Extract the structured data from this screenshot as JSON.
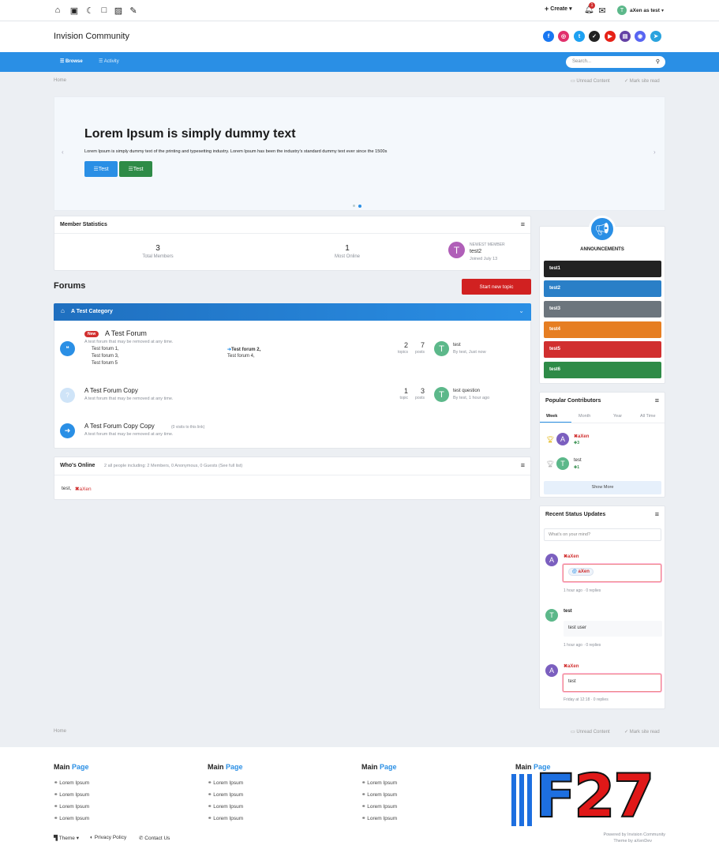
{
  "topbar": {
    "create_label": "Create",
    "notif_count": "1",
    "user_label": "aXen as test",
    "user_initial": "T"
  },
  "header": {
    "brand": "Invision Community"
  },
  "nav": {
    "browse": "Browse",
    "activity": "Activity",
    "search_placeholder": "Search..."
  },
  "breadcrumb": {
    "home": "Home",
    "unread": "Unread Content",
    "mark_read": "Mark site read"
  },
  "hero": {
    "title": "Lorem Ipsum is simply dummy text",
    "text": "Lorem Ipsum is simply dummy text of the printing and typesetting industry. Lorem Ipsum has been the industry's standard dummy text ever since the 1500s",
    "btn1": "Test",
    "btn2": "Test"
  },
  "stats": {
    "title": "Member Statistics",
    "total_members_value": "3",
    "total_members_label": "Total Members",
    "most_online_value": "1",
    "most_online_label": "Most Online",
    "newest_label": "NEWEST MEMBER",
    "newest_name": "test2",
    "newest_joined": "Joined July 13",
    "newest_initial": "T"
  },
  "forums": {
    "title": "Forums",
    "start_topic": "Start new topic",
    "category": "A Test Category",
    "items": [
      {
        "badge": "New",
        "name": "A Test Forum",
        "desc": "A test forum that may be removed at any time.",
        "sub1": "Test forum 1,",
        "sub2": "Test forum 3,",
        "sub3": "Test forum 5",
        "sub4": "Test forum 2,",
        "sub5": "Test forum 4,",
        "topics": "2",
        "topics_label": "topics",
        "posts": "7",
        "posts_label": "posts",
        "last_title": "test",
        "last_by": "By test, Just now",
        "last_initial": "T"
      },
      {
        "name": "A Test Forum Copy",
        "desc": "A test forum that may be removed at any time.",
        "topics": "1",
        "topics_label": "topic",
        "posts": "3",
        "posts_label": "posts",
        "last_title": "test question",
        "last_by": "By test, 1 hour ago",
        "last_initial": "T"
      },
      {
        "name": "A Test Forum Copy Copy",
        "visits": "(0 visits to this link)",
        "desc": "A test forum that may be removed at any time."
      }
    ]
  },
  "online": {
    "title": "Who's Online",
    "summary": "2 all people including: 2 Members, 0 Anonymous, 0 Guests (See full list)",
    "user1": "test,",
    "user2": "aXen"
  },
  "announcements": {
    "title": "ANNOUNCEMENTS",
    "items": [
      "test1",
      "test2",
      "test3",
      "test4",
      "test5",
      "test6"
    ],
    "colors": [
      "#222222",
      "#2a7fc7",
      "#6c757d",
      "#e67e22",
      "#d12f2f",
      "#2e8b47"
    ]
  },
  "contributors": {
    "title": "Popular Contributors",
    "tabs": [
      "Week",
      "Month",
      "Year",
      "All Time"
    ],
    "user1": "aXen",
    "user1_rep": "3",
    "user1_initial": "A",
    "user2": "test",
    "user2_rep": "1",
    "user2_initial": "T",
    "show_more": "Show More"
  },
  "status": {
    "title": "Recent Status Updates",
    "placeholder": "What's on your mind?",
    "items": [
      {
        "initial": "A",
        "author": "aXen",
        "body": "aXen",
        "meta": "1 hour ago · 0 replies"
      },
      {
        "initial": "T",
        "author": "test",
        "body": "test user",
        "meta": "1 hour ago · 0 replies"
      },
      {
        "initial": "A",
        "author": "aXen",
        "body": "test",
        "meta": "Friday at 12:18 · 0 replies"
      }
    ]
  },
  "footer": {
    "home": "Home",
    "unread": "Unread Content",
    "mark_read": "Mark site read",
    "col_title_a": "Main",
    "col_title_b": "Page",
    "link": "Lorem Ipsum",
    "theme": "Theme",
    "privacy": "Privacy Policy",
    "contact": "Contact Us",
    "powered": "Powered by Invision Community",
    "theme_by": "Theme by aXenDev",
    "watermark": "F27"
  },
  "colors": {
    "accent": "#2a8fe5",
    "red": "#d12f2f",
    "green": "#2e8b47"
  }
}
